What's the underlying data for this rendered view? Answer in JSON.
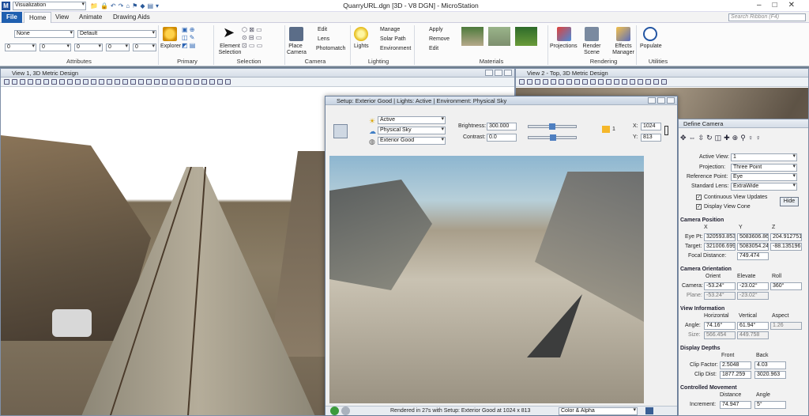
{
  "app": {
    "title": "QuarryURL.dgn [3D - V8 DGN] - MicroStation",
    "workflow": "Visualization",
    "search_placeholder": "Search Ribbon (F4)"
  },
  "tabs": [
    "File",
    "Home",
    "View",
    "Animate",
    "Drawing Aids"
  ],
  "attributes": {
    "level": "None",
    "style": "Default",
    "v1": "0",
    "v2": "0",
    "v3": "0",
    "v4": "0",
    "v5": "0",
    "label": "Attributes"
  },
  "primary": {
    "explorer": "Explorer",
    "label": "Primary"
  },
  "selection": {
    "element_selection": "Element Selection",
    "label": "Selection"
  },
  "camera": {
    "place": "Place Camera",
    "edit": "Edit",
    "lens": "Lens",
    "photomatch": "Photomatch",
    "label": "Camera"
  },
  "lighting": {
    "lights": "Lights",
    "manage": "Manage",
    "solar": "Solar Path",
    "environment": "Environment",
    "label": "Lighting"
  },
  "materials": {
    "apply": "Apply",
    "remove": "Remove",
    "edit": "Edit",
    "label": "Materials"
  },
  "rendering": {
    "projections": "Projections",
    "render_scene": "Render Scene",
    "effects": "Effects Manager",
    "label": "Rendering"
  },
  "utilities": {
    "populate": "Populate",
    "label": "Utilities"
  },
  "view1": {
    "title": "View 1, 3D Metric Design"
  },
  "view2": {
    "title": "View 2 - Top, 3D Metric Design"
  },
  "render": {
    "title": "Setup: Exterior Good | Lights: Active | Environment: Physical Sky",
    "light_setup": "Active",
    "environment": "Physical Sky",
    "render_setup": "Exterior Good",
    "brightness_label": "Brightness:",
    "brightness": "300.000",
    "contrast_label": "Contrast:",
    "contrast": "0.0",
    "x_label": "X:",
    "x": "1024",
    "y_label": "Y:",
    "y": "813",
    "count": "1",
    "status": "Rendered in 27s with Setup: Exterior Good at 1024 x 813",
    "color_mode": "Color & Alpha"
  },
  "camera_dialog": {
    "title": "Define Camera",
    "active_view_label": "Active View:",
    "active_view": "1",
    "projection_label": "Projection:",
    "projection": "Three Point",
    "refpoint_label": "Reference Point:",
    "refpoint": "Eye",
    "lens_label": "Standard Lens:",
    "lens": "ExtraWide",
    "cont_updates": "Continuous View Updates",
    "display_cone": "Display View Cone",
    "hide": "Hide",
    "pos_head": "Camera Position",
    "col_x": "X",
    "col_y": "Y",
    "col_z": "Z",
    "eye_label": "Eye Pt:",
    "eye": [
      "320593.853",
      "5083606.86",
      "204.912751"
    ],
    "target_label": "Target:",
    "target": [
      "321006.699",
      "5083054.24",
      "-88.135196"
    ],
    "focal_label": "Focal Distance:",
    "focal": "749.474",
    "orient_head": "Camera Orientation",
    "col_orient": "Orient",
    "col_elev": "Elevate",
    "col_roll": "Roll",
    "camera_label": "Camera:",
    "camera": [
      "-53.24°",
      "-23.02°",
      "360°"
    ],
    "plane_label": "Plane:",
    "plane": [
      "-53.24°",
      "-23.02°"
    ],
    "view_head": "View Information",
    "col_h": "Horizontal",
    "col_v": "Vertical",
    "col_a": "Aspect",
    "angle_label": "Angle:",
    "angle": [
      "74.16°",
      "61.94°",
      "1.26"
    ],
    "size_label": "Size:",
    "size": [
      "566.454",
      "449.758"
    ],
    "depth_head": "Display Depths",
    "col_front": "Front",
    "col_back": "Back",
    "clipf_label": "Clip Factor:",
    "clipf": [
      "2.5048",
      "4.03"
    ],
    "clipd_label": "Clip Dist:",
    "clipd": [
      "1877.259",
      "3020.963"
    ],
    "move_head": "Controlled Movement",
    "col_dist": "Distance",
    "col_angle": "Angle",
    "inc_label": "Increment:",
    "inc": [
      "74.947",
      "5°"
    ]
  }
}
